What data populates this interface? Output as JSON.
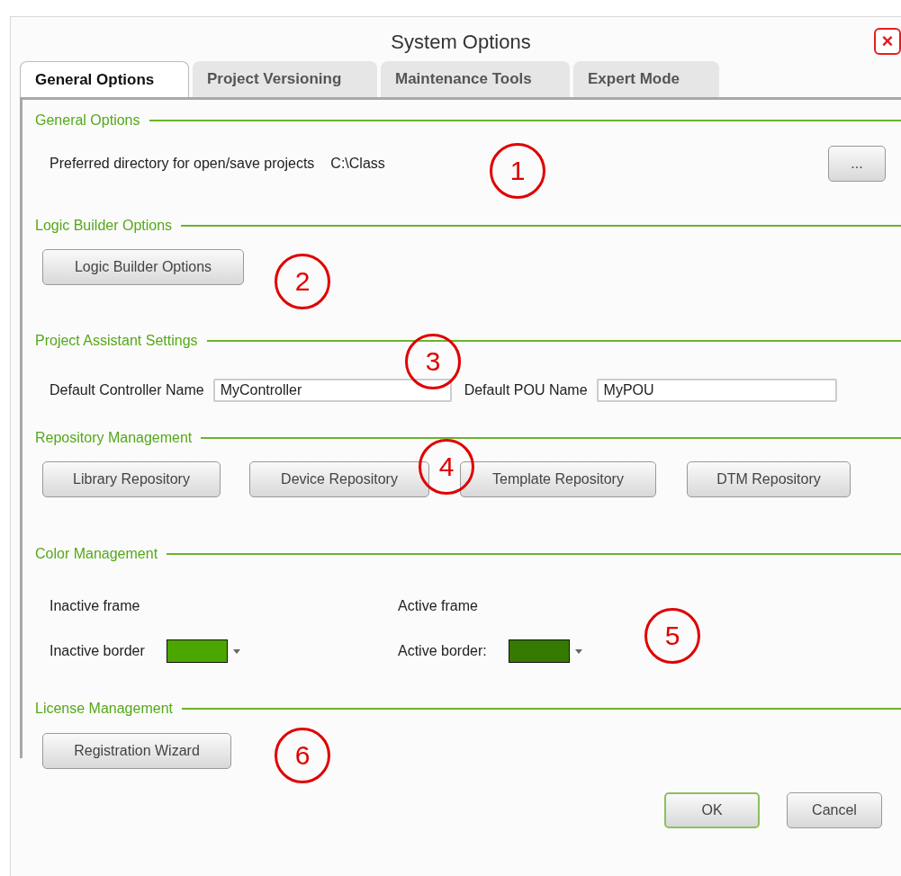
{
  "window": {
    "title": "System Options",
    "close": "×"
  },
  "tabs": [
    {
      "label": "General Options",
      "selected": true
    },
    {
      "label": "Project Versioning",
      "selected": false
    },
    {
      "label": "Maintenance Tools",
      "selected": false
    },
    {
      "label": "Expert Mode",
      "selected": false
    }
  ],
  "general": {
    "heading": "General Options",
    "label": "Preferred directory for open/save projects",
    "value": "C:\\Class",
    "browse": "..."
  },
  "logic_builder": {
    "heading": "Logic Builder Options",
    "button": "Logic Builder Options"
  },
  "project_assistant": {
    "heading": "Project Assistant Settings",
    "fields": [
      {
        "label": "Default Controller Name",
        "value": "MyController"
      },
      {
        "label": "Default POU Name",
        "value": "MyPOU"
      }
    ]
  },
  "repository": {
    "heading": "Repository Management",
    "buttons": [
      "Library Repository",
      "Device Repository",
      "Template Repository",
      "DTM Repository"
    ]
  },
  "color_management": {
    "heading": "Color Management",
    "columns": [
      {
        "frame": "Inactive frame",
        "border_label": "Inactive border",
        "color": "#4ca600"
      },
      {
        "frame": "Active frame",
        "border_label": "Active border:",
        "color": "#357a00"
      }
    ]
  },
  "license": {
    "heading": "License Management",
    "button": "Registration Wizard"
  },
  "buttons": [
    {
      "label": "OK",
      "kind": "default"
    },
    {
      "label": "Cancel",
      "kind": "normal"
    }
  ],
  "callouts": [
    "1",
    "2",
    "3",
    "4",
    "5",
    "6"
  ]
}
